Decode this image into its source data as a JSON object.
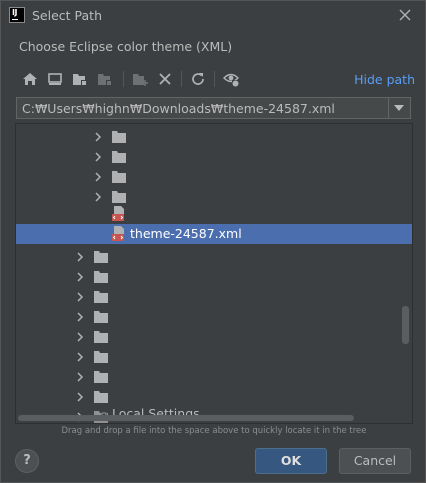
{
  "window": {
    "title": "Select Path"
  },
  "description": "Choose Eclipse color theme (XML)",
  "toolbar": {
    "icons": [
      "home-icon",
      "desktop-icon",
      "project-folder-icon",
      "module-folder-icon",
      "new-folder-icon",
      "delete-icon",
      "refresh-icon",
      "show-hidden-icon"
    ],
    "hide_path_label": "Hide path"
  },
  "path": {
    "value": "C:₩Users₩highn₩Downloads₩theme-24587.xml"
  },
  "tree": {
    "rows": [
      {
        "type": "folder",
        "label": "",
        "expandable": true
      },
      {
        "type": "folder",
        "label": "",
        "expandable": true
      },
      {
        "type": "folder",
        "label": "",
        "expandable": true
      },
      {
        "type": "folder",
        "label": "",
        "expandable": true
      },
      {
        "type": "xml-file",
        "label": ""
      },
      {
        "type": "xml-file",
        "label": "theme-24587.xml",
        "selected": true
      },
      {
        "type": "folder",
        "label": "",
        "expandable": true
      },
      {
        "type": "folder",
        "label": "",
        "expandable": true
      },
      {
        "type": "folder",
        "label": "",
        "expandable": true
      },
      {
        "type": "folder",
        "label": "",
        "expandable": true
      },
      {
        "type": "folder",
        "label": "",
        "expandable": true
      },
      {
        "type": "folder",
        "label": "",
        "expandable": true
      },
      {
        "type": "folder",
        "label": "",
        "expandable": true
      },
      {
        "type": "folder",
        "label": "",
        "expandable": true
      },
      {
        "type": "folder",
        "label": "Local Settings",
        "expandable": true,
        "hidden": true
      }
    ]
  },
  "hint": "Drag and drop a file into the space above to quickly locate it in the tree",
  "buttons": {
    "help": "?",
    "ok": "OK",
    "cancel": "Cancel"
  },
  "colors": {
    "accent": "#4b6eaf",
    "link": "#589df6",
    "background": "#3c3f41",
    "ok_button": "#365880"
  }
}
